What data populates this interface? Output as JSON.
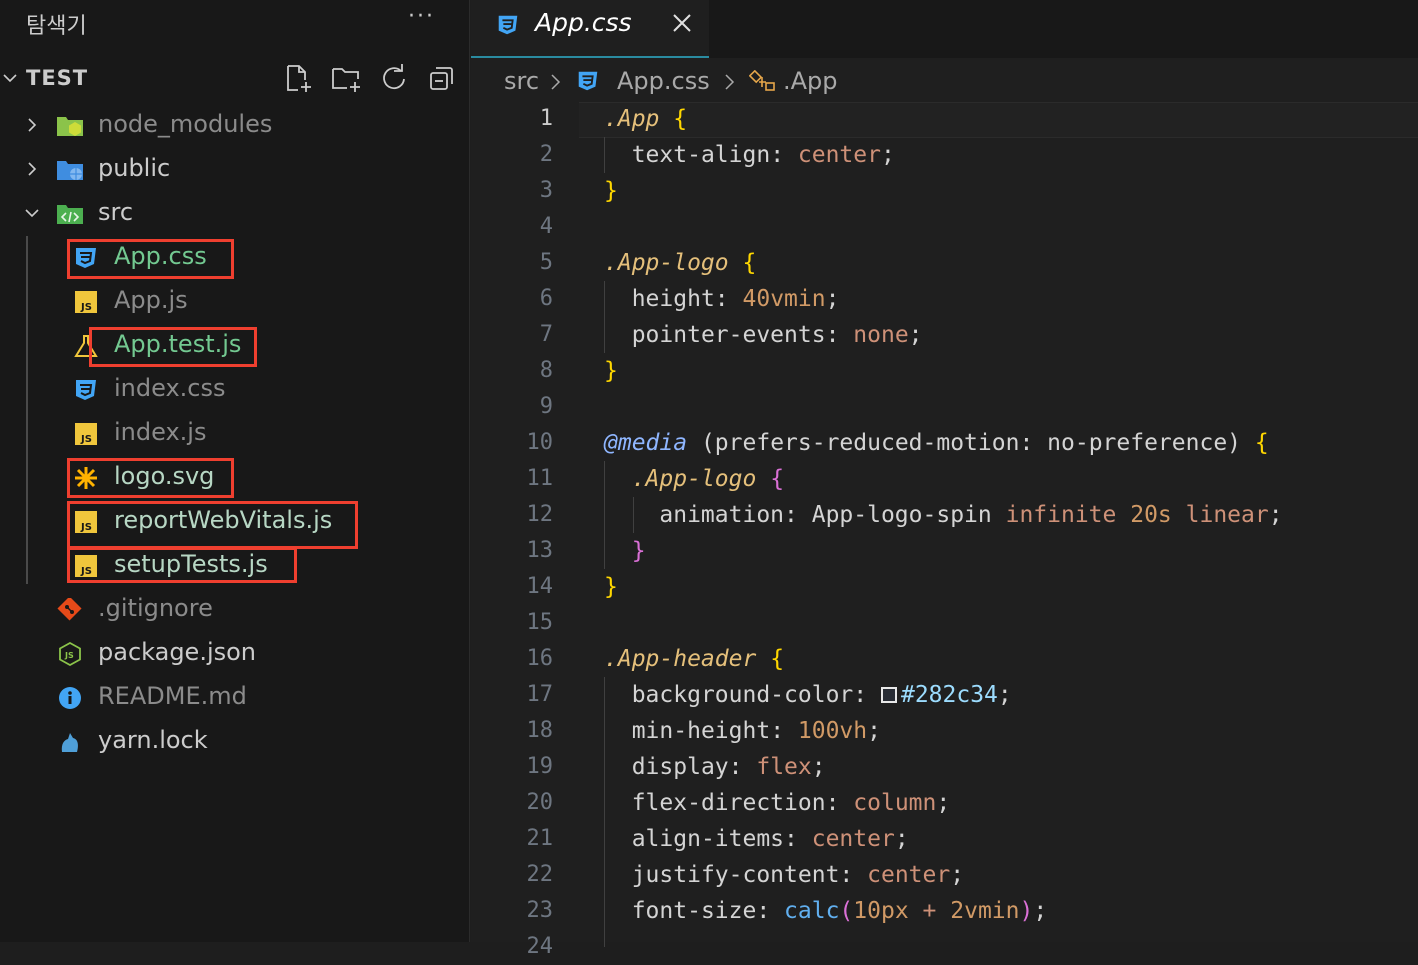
{
  "sidebar": {
    "title": "탐색기",
    "more": "···",
    "section": "TEST",
    "actions": [
      "new-file-icon",
      "new-folder-icon",
      "refresh-icon",
      "collapse-all-icon"
    ],
    "items": [
      {
        "label": "node_modules",
        "icon": "folder-node-icon",
        "type": "folder",
        "expanded": false
      },
      {
        "label": "public",
        "icon": "folder-public-icon",
        "type": "folder",
        "expanded": false
      },
      {
        "label": "src",
        "icon": "folder-src-icon",
        "type": "folder",
        "expanded": true
      },
      {
        "label": "App.css",
        "icon": "css-file-icon",
        "highlighted": true
      },
      {
        "label": "App.js",
        "icon": "js-file-icon",
        "highlighted": false
      },
      {
        "label": "App.test.js",
        "icon": "test-file-icon",
        "highlighted": true
      },
      {
        "label": "index.css",
        "icon": "css-file-icon",
        "highlighted": false
      },
      {
        "label": "index.js",
        "icon": "js-file-icon",
        "highlighted": false
      },
      {
        "label": "logo.svg",
        "icon": "svg-file-icon",
        "highlighted": true
      },
      {
        "label": "reportWebVitals.js",
        "icon": "js-file-icon",
        "highlighted": true
      },
      {
        "label": "setupTests.js",
        "icon": "js-file-icon",
        "highlighted": true
      },
      {
        "label": ".gitignore",
        "icon": "git-file-icon"
      },
      {
        "label": "package.json",
        "icon": "node-file-icon"
      },
      {
        "label": "README.md",
        "icon": "info-file-icon"
      },
      {
        "label": "yarn.lock",
        "icon": "yarn-file-icon"
      }
    ]
  },
  "editor": {
    "tab": {
      "label": "App.css",
      "icon": "css-file-icon"
    },
    "breadcrumb": {
      "folder": "src",
      "file": "App.css",
      "symbol": ".App"
    },
    "line_numbers": [
      "1",
      "2",
      "3",
      "4",
      "5",
      "6",
      "7",
      "8",
      "9",
      "10",
      "11",
      "12",
      "13",
      "14",
      "15",
      "16",
      "17",
      "18",
      "19",
      "20",
      "21",
      "22",
      "23",
      "24"
    ],
    "code": {
      "l1_sel": ".App",
      "l1_br": "{",
      "l2_prop": "text-align",
      "l2_val": "center",
      "l3_br": "}",
      "l5_sel": ".App-logo",
      "l5_br": "{",
      "l6_prop": "height",
      "l6_val": "40vmin",
      "l7_prop": "pointer-events",
      "l7_val": "none",
      "l8_br": "}",
      "l10_kw": "@media",
      "l10_q": "(prefers-reduced-motion",
      "l10_v": "no-preference)",
      "l10_br": "{",
      "l11_sel": ".App-logo",
      "l11_br": "{",
      "l12_prop": "animation",
      "l12_name": "App-logo-spin",
      "l12_v1": "infinite",
      "l12_v2": "20s",
      "l12_v3": "linear",
      "l13_br": "}",
      "l14_br": "}",
      "l16_sel": ".App-header",
      "l16_br": "{",
      "l17_prop": "background-color",
      "l17_val": "#282c34",
      "l18_prop": "min-height",
      "l18_val": "100vh",
      "l19_prop": "display",
      "l19_val": "flex",
      "l20_prop": "flex-direction",
      "l20_val": "column",
      "l21_prop": "align-items",
      "l21_val": "center",
      "l22_prop": "justify-content",
      "l22_val": "center",
      "l23_prop": "font-size",
      "l23_fn": "calc",
      "l23_a": "10px",
      "l23_op": "+",
      "l23_b": "2vmin"
    }
  },
  "colors": {
    "accent": "#2a8ba0",
    "highlight_box": "#ef3f2f",
    "swatch": "#282c34"
  }
}
